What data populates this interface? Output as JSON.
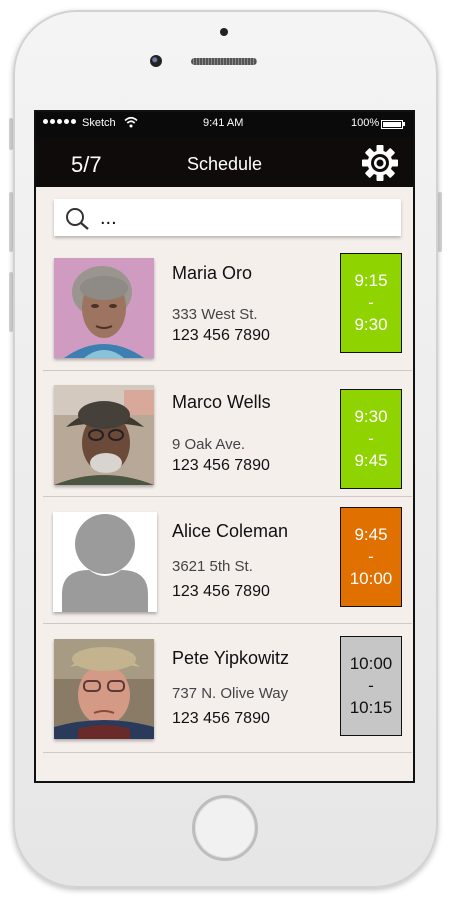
{
  "status_bar": {
    "carrier": "Sketch",
    "time": "9:41 AM",
    "battery": "100%"
  },
  "nav": {
    "count": "5/7",
    "title": "Schedule",
    "settings_icon": "gear-icon"
  },
  "search": {
    "value": "...",
    "icon": "search-icon"
  },
  "appointments": [
    {
      "name": "Maria Oro",
      "address": "333 West St.",
      "phone": "123 456 7890",
      "start": "9:15",
      "sep": "-",
      "end": "9:30",
      "slot_color": "#8fd400",
      "slot_text_color": "#ffffff"
    },
    {
      "name": "Marco Wells",
      "address": "9 Oak Ave.",
      "phone": "123 456 7890",
      "start": "9:30",
      "sep": "-",
      "end": "9:45",
      "slot_color": "#8fd400",
      "slot_text_color": "#ffffff"
    },
    {
      "name": "Alice Coleman",
      "address": "3621 5th St.",
      "phone": "123 456 7890",
      "start": "9:45",
      "sep": "-",
      "end": "10:00",
      "slot_color": "#e07000",
      "slot_text_color": "#ffffff"
    },
    {
      "name": "Pete Yipkowitz",
      "address": "737 N. Olive Way",
      "phone": "123 456 7890",
      "start": "10:00",
      "sep": "-",
      "end": "10:15",
      "slot_color": "#c6c6c6",
      "slot_text_color": "#111111"
    }
  ]
}
